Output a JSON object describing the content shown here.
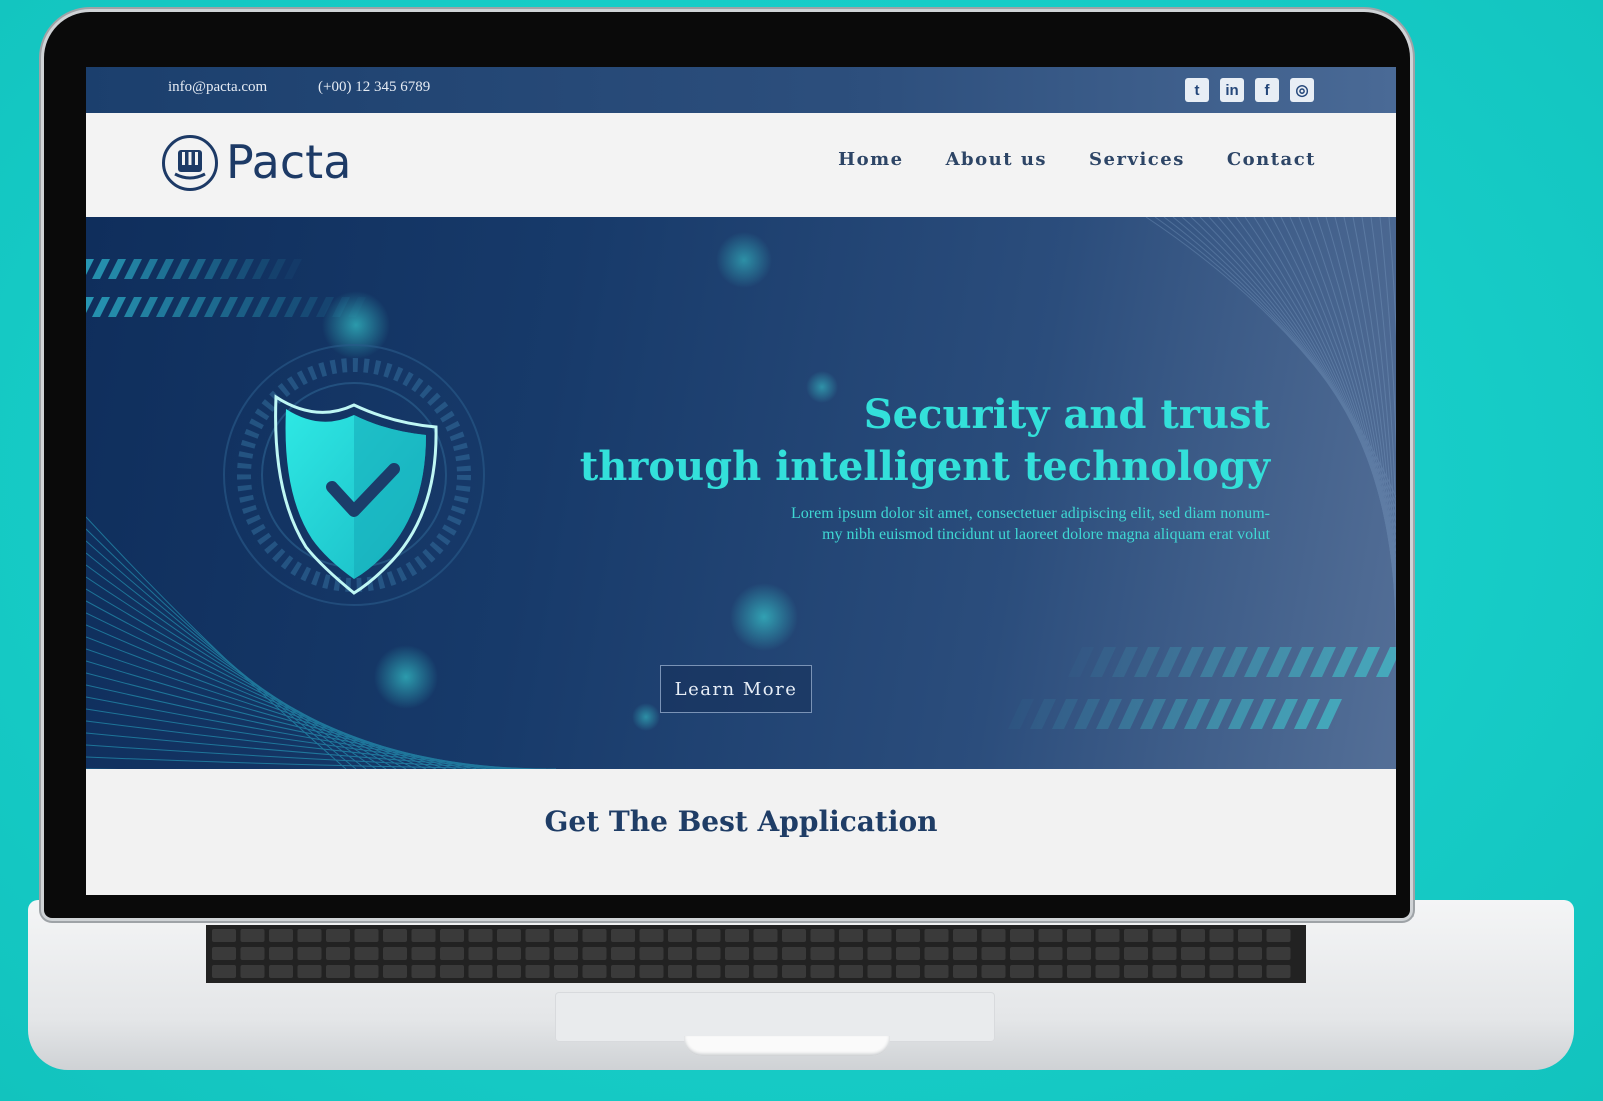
{
  "topbar": {
    "email": "info@pacta.com",
    "phone": "(+00) 12 345 6789",
    "social": [
      {
        "icon": "twitter-icon",
        "glyph": "t"
      },
      {
        "icon": "linkedin-icon",
        "glyph": "in"
      },
      {
        "icon": "facebook-icon",
        "glyph": "f"
      },
      {
        "icon": "instagram-icon",
        "glyph": "◎"
      }
    ]
  },
  "brand": {
    "name": "Pacta"
  },
  "nav": [
    "Home",
    "About us",
    "Services",
    "Contact"
  ],
  "hero": {
    "title_line1": "Security and trust",
    "title_line2": "through intelligent technology",
    "subtitle_line1": "Lorem ipsum dolor sit amet, consectetuer adipiscing elit, sed diam nonum-",
    "subtitle_line2": "my nibh euismod tincidunt ut laoreet dolore magna aliquam erat volut",
    "button": "Learn More"
  },
  "section": {
    "heading": "Get The Best Application"
  },
  "colors": {
    "background": "#1bd1cc",
    "navy": "#1d3a66",
    "accent": "#33e0da"
  }
}
